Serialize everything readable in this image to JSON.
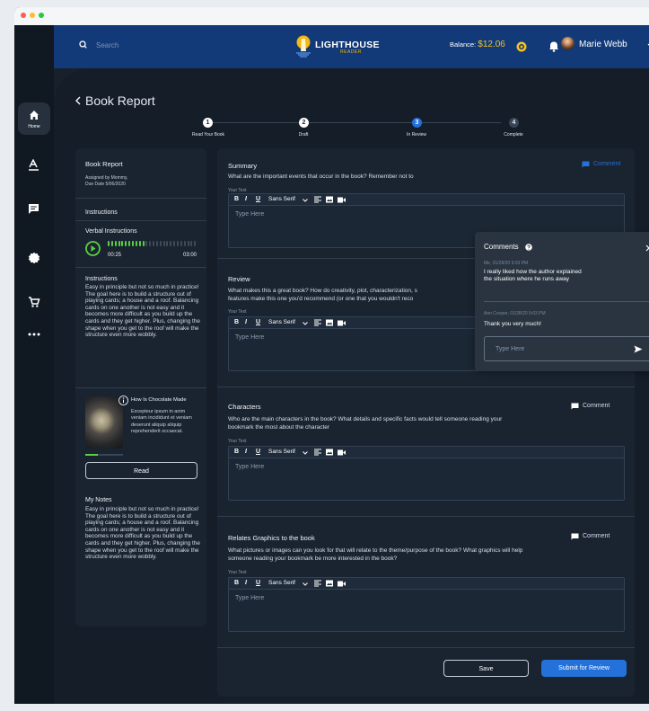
{
  "app": {
    "search_placeholder": "Search",
    "brand_title": "LIGHTHOUSE",
    "brand_subtitle": "READER",
    "balance_label": "Balance:",
    "balance_value": "$12.06",
    "user_name": "Marie Webb"
  },
  "sidebar": {
    "home_label": "Home"
  },
  "page": {
    "back_icon": "chevron-left-icon",
    "title": "Book Report",
    "steps": [
      {
        "number": "1",
        "label": "Read Your Book"
      },
      {
        "number": "2",
        "label": "Draft"
      },
      {
        "number": "3",
        "label": "In Review"
      },
      {
        "number": "4",
        "label": "Complete"
      }
    ]
  },
  "left": {
    "title": "Book Report",
    "assigned": "Assigned by Mommy,",
    "due": "Due Date 5/06/2020",
    "instructions_heading": "Instructions",
    "verbal_heading": "Verbal Instructions",
    "audio_current": "00:25",
    "audio_total": "03:00",
    "audio_progress": 0.43,
    "instructions_title": "Instructions",
    "instructions_text": "Easy in principle but not so much in practice! The goal here is to build a structure out of playing cards; a house and a roof. Balancing cards on one another is not easy and it becomes more difficult as you build up the cards and they get higher. Plus, changing the shape when you get to the roof will make the structure even more wobbly.",
    "book_title": "How Is Chocolate Made",
    "book_summary": "Excepteur ipsum in anim veniam incididunt et veniam deserunt aliquip aliquip reprehenderit occaecat.",
    "read_button": "Read",
    "notes_title": "My Notes",
    "notes_text": "Easy in principle but not so much in practice! The goal here is to build a structure out of playing cards; a house and a roof. Balancing cards on one another is not easy and it becomes more difficult as you build up the cards and they get higher. Plus, changing the shape when you get to the roof will make the structure even more wobbly."
  },
  "sections": {
    "summary": {
      "title": "Summary",
      "prompt": "What are the important events that occur in the book? Remember not to",
      "comment": "Comment",
      "label": "Your Text",
      "placeholder": "Type Here"
    },
    "review": {
      "title": "Review",
      "prompt_1": "What makes this a great book? How do creativity, plot, characterization, s",
      "prompt_2": "features make this one you'd recommend (or one that you wouldn't reco",
      "label": "Your Text",
      "placeholder": "Type Here"
    },
    "characters": {
      "title": "Characters",
      "prompt_1": "Who are the main characters in the book? What details and specific facts would tell someone reading your",
      "prompt_2": "bookmark the most about the character",
      "comment": "Comment",
      "label": "Your Text",
      "placeholder": "Type Here"
    },
    "graphics": {
      "title": "Relates Graphics to the book",
      "prompt_1": "What pictures or images can you look for that will relate to the theme/purpose of the book? What graphics will help",
      "prompt_2": "someone reading your bookmark be more interested in the book?",
      "comment": "Comment",
      "label": "Your Text",
      "placeholder": "Type Here"
    }
  },
  "toolbar": {
    "bold": "B",
    "italic": "I",
    "underline": "U",
    "font": "Sans Serif"
  },
  "comments_popup": {
    "title": "Comments",
    "first_meta": "Me, 01/28/20 9:03 PM",
    "first_text": "I really liked how the author explained the situation where he runs away",
    "second_meta": "Ann Cooper, 01/28/20 9:03 PM",
    "second_text": "Thank you very much!",
    "input_placeholder": "Type Here"
  },
  "footer": {
    "save": "Save",
    "submit": "Submit for Review"
  },
  "colors": {
    "accent": "#2371d9",
    "warning": "#f7c21c",
    "success": "#5bcf3f",
    "text_dim": "#8c9bb0"
  }
}
